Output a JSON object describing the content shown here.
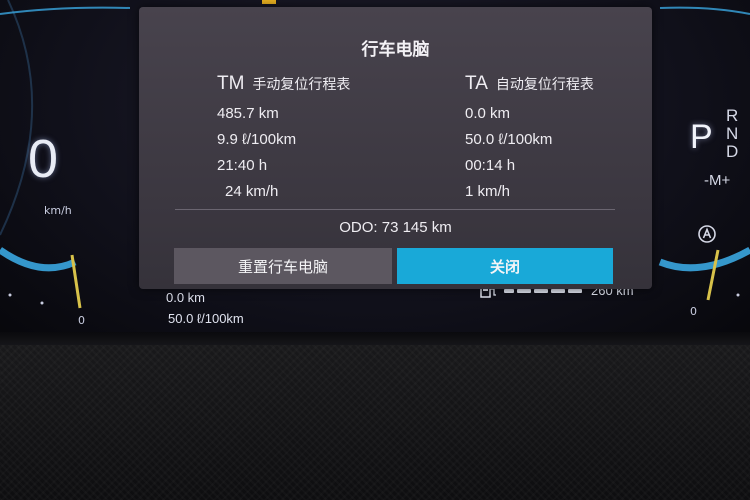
{
  "cluster": {
    "speed": {
      "value": "0",
      "unit": "km/h",
      "left_zero": "0"
    },
    "right_gauge_zero": "0",
    "gear": {
      "selected": "P",
      "options": [
        "R",
        "N",
        "D"
      ],
      "manual": "-M+"
    },
    "trip_bottom": {
      "distance": "0.0 km",
      "consumption": "50.0 ℓ/100km"
    },
    "range": {
      "value": "260 km",
      "level": 0.75
    }
  },
  "trip_computer": {
    "title": "行车电脑",
    "tm": {
      "abbr": "TM",
      "name": "手动复位行程表",
      "distance": "485.7 km",
      "consumption": "9.9 ℓ/100km",
      "time": "21:40 h",
      "avg_speed": "24 km/h"
    },
    "ta": {
      "abbr": "TA",
      "name": "自动复位行程表",
      "distance": "0.0 km",
      "consumption": "50.0 ℓ/100km",
      "time": "00:14 h",
      "avg_speed": "1 km/h"
    },
    "odo": "ODO:  73 145 km",
    "reset_label": "重置行车电脑",
    "close_label": "关闭"
  },
  "colors": {
    "accent": "#19a9d8",
    "panel": "#3d3942",
    "gauge_blue": "#3aa6e0",
    "gauge_yellow": "#d8c24a"
  }
}
